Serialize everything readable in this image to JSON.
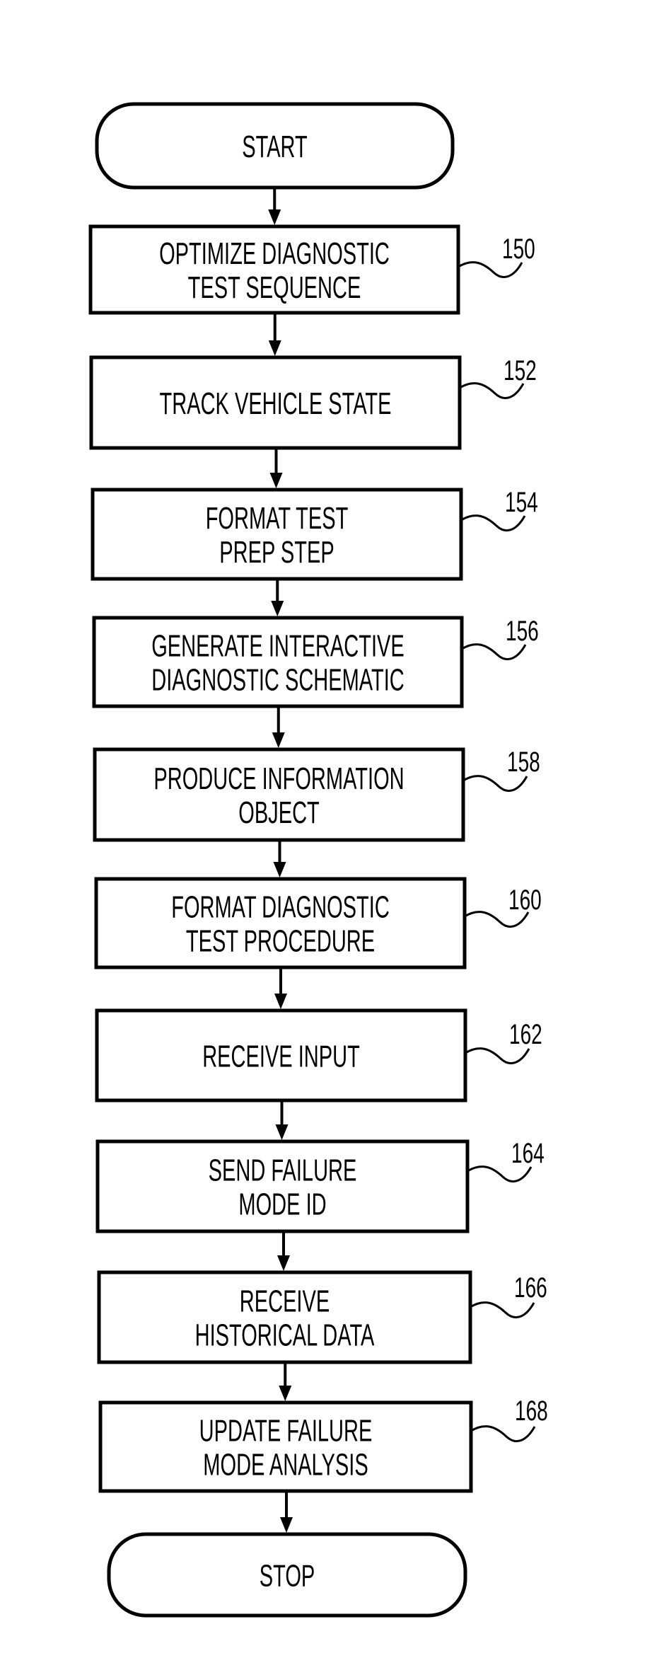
{
  "figure": {
    "terminals": {
      "start": {
        "label": "START"
      },
      "stop": {
        "label": "STOP"
      }
    },
    "steps": [
      {
        "ref": "150",
        "lines": [
          "OPTIMIZE DIAGNOSTIC",
          "TEST SEQUENCE"
        ]
      },
      {
        "ref": "152",
        "lines": [
          "TRACK VEHICLE STATE"
        ]
      },
      {
        "ref": "154",
        "lines": [
          "FORMAT TEST",
          "PREP STEP"
        ]
      },
      {
        "ref": "156",
        "lines": [
          "GENERATE INTERACTIVE",
          "DIAGNOSTIC SCHEMATIC"
        ]
      },
      {
        "ref": "158",
        "lines": [
          "PRODUCE INFORMATION",
          "OBJECT"
        ]
      },
      {
        "ref": "160",
        "lines": [
          "FORMAT DIAGNOSTIC",
          "TEST PROCEDURE"
        ]
      },
      {
        "ref": "162",
        "lines": [
          "RECEIVE INPUT"
        ]
      },
      {
        "ref": "164",
        "lines": [
          "SEND FAILURE",
          "MODE ID"
        ]
      },
      {
        "ref": "166",
        "lines": [
          "RECEIVE",
          "HISTORICAL DATA"
        ]
      },
      {
        "ref": "168",
        "lines": [
          "UPDATE FAILURE",
          "MODE ANALYSIS"
        ]
      }
    ],
    "flow": [
      "start",
      "150",
      "152",
      "154",
      "156",
      "158",
      "160",
      "162",
      "164",
      "166",
      "168",
      "stop"
    ],
    "colors": {
      "ink": "#000000",
      "paper": "#ffffff"
    }
  }
}
